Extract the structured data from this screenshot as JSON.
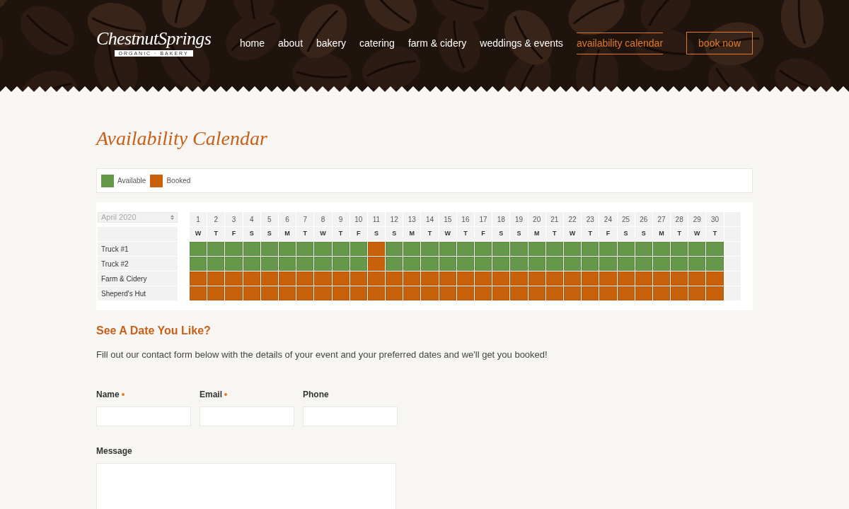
{
  "logo": {
    "name": "ChestnutSprings",
    "banner": "ORGANIC · BAKERY"
  },
  "nav": [
    {
      "label": "home",
      "selected": false
    },
    {
      "label": "about",
      "selected": false
    },
    {
      "label": "bakery",
      "selected": false
    },
    {
      "label": "catering",
      "selected": false
    },
    {
      "label": "farm & cidery",
      "selected": false
    },
    {
      "label": "weddings & events",
      "selected": false
    },
    {
      "label": "availability calendar",
      "selected": true
    }
  ],
  "book_button": "book now",
  "title": "Availability Calendar",
  "legend": [
    {
      "label": "Available",
      "color": "#66984a"
    },
    {
      "label": "Booked",
      "color": "#c9600c"
    }
  ],
  "calendar": {
    "month": "April 2020",
    "days": [
      {
        "day": "1",
        "weekday": "W"
      },
      {
        "day": "2",
        "weekday": "T"
      },
      {
        "day": "3",
        "weekday": "F"
      },
      {
        "day": "4",
        "weekday": "S"
      },
      {
        "day": "5",
        "weekday": "S"
      },
      {
        "day": "6",
        "weekday": "M"
      },
      {
        "day": "7",
        "weekday": "T"
      },
      {
        "day": "8",
        "weekday": "W"
      },
      {
        "day": "9",
        "weekday": "T"
      },
      {
        "day": "10",
        "weekday": "F"
      },
      {
        "day": "11",
        "weekday": "S"
      },
      {
        "day": "12",
        "weekday": "S"
      },
      {
        "day": "13",
        "weekday": "M"
      },
      {
        "day": "14",
        "weekday": "T"
      },
      {
        "day": "15",
        "weekday": "W"
      },
      {
        "day": "16",
        "weekday": "T"
      },
      {
        "day": "17",
        "weekday": "F"
      },
      {
        "day": "18",
        "weekday": "S"
      },
      {
        "day": "19",
        "weekday": "S"
      },
      {
        "day": "20",
        "weekday": "M"
      },
      {
        "day": "21",
        "weekday": "T"
      },
      {
        "day": "22",
        "weekday": "W"
      },
      {
        "day": "23",
        "weekday": "T"
      },
      {
        "day": "24",
        "weekday": "F"
      },
      {
        "day": "25",
        "weekday": "S"
      },
      {
        "day": "26",
        "weekday": "S"
      },
      {
        "day": "27",
        "weekday": "M"
      },
      {
        "day": "28",
        "weekday": "T"
      },
      {
        "day": "29",
        "weekday": "W"
      },
      {
        "day": "30",
        "weekday": "T"
      }
    ],
    "rows": [
      {
        "name": "Truck #1",
        "cells": [
          {
            "booked": false
          },
          {
            "booked": false
          },
          {
            "booked": false
          },
          {
            "booked": false
          },
          {
            "booked": false
          },
          {
            "booked": false
          },
          {
            "booked": false
          },
          {
            "booked": false
          },
          {
            "booked": false
          },
          {
            "booked": false
          },
          {
            "booked": true
          },
          {
            "booked": false
          },
          {
            "booked": false
          },
          {
            "booked": false
          },
          {
            "booked": false
          },
          {
            "booked": false
          },
          {
            "booked": false
          },
          {
            "booked": false
          },
          {
            "booked": false
          },
          {
            "booked": false
          },
          {
            "booked": false
          },
          {
            "booked": false
          },
          {
            "booked": false
          },
          {
            "booked": false
          },
          {
            "booked": false
          },
          {
            "booked": false
          },
          {
            "booked": false
          },
          {
            "booked": false
          },
          {
            "booked": false
          },
          {
            "booked": false
          }
        ]
      },
      {
        "name": "Truck #2",
        "cells": [
          {
            "booked": false
          },
          {
            "booked": false
          },
          {
            "booked": false
          },
          {
            "booked": false
          },
          {
            "booked": false
          },
          {
            "booked": false
          },
          {
            "booked": false
          },
          {
            "booked": false
          },
          {
            "booked": false
          },
          {
            "booked": false
          },
          {
            "booked": true
          },
          {
            "booked": false
          },
          {
            "booked": false
          },
          {
            "booked": false
          },
          {
            "booked": false
          },
          {
            "booked": false
          },
          {
            "booked": false
          },
          {
            "booked": false
          },
          {
            "booked": false
          },
          {
            "booked": false
          },
          {
            "booked": false
          },
          {
            "booked": false
          },
          {
            "booked": false
          },
          {
            "booked": false
          },
          {
            "booked": false
          },
          {
            "booked": false
          },
          {
            "booked": false
          },
          {
            "booked": false
          },
          {
            "booked": false
          },
          {
            "booked": false
          }
        ]
      },
      {
        "name": "Farm & Cidery",
        "cells": [
          {
            "booked": true
          },
          {
            "booked": true
          },
          {
            "booked": true
          },
          {
            "booked": true
          },
          {
            "booked": true
          },
          {
            "booked": true
          },
          {
            "booked": true
          },
          {
            "booked": true
          },
          {
            "booked": true
          },
          {
            "booked": true
          },
          {
            "booked": true
          },
          {
            "booked": true
          },
          {
            "booked": true
          },
          {
            "booked": true
          },
          {
            "booked": true
          },
          {
            "booked": true
          },
          {
            "booked": true
          },
          {
            "booked": true
          },
          {
            "booked": true
          },
          {
            "booked": true
          },
          {
            "booked": true
          },
          {
            "booked": true
          },
          {
            "booked": true
          },
          {
            "booked": true
          },
          {
            "booked": true
          },
          {
            "booked": true
          },
          {
            "booked": true
          },
          {
            "booked": true
          },
          {
            "booked": true
          },
          {
            "booked": true
          }
        ]
      },
      {
        "name": "Sheperd's Hut",
        "cells": [
          {
            "booked": true
          },
          {
            "booked": true
          },
          {
            "booked": true
          },
          {
            "booked": true
          },
          {
            "booked": true
          },
          {
            "booked": true
          },
          {
            "booked": true
          },
          {
            "booked": true
          },
          {
            "booked": true
          },
          {
            "booked": true
          },
          {
            "booked": true
          },
          {
            "booked": true
          },
          {
            "booked": true
          },
          {
            "booked": true
          },
          {
            "booked": true
          },
          {
            "booked": true
          },
          {
            "booked": true
          },
          {
            "booked": true
          },
          {
            "booked": true
          },
          {
            "booked": true
          },
          {
            "booked": true
          },
          {
            "booked": true
          },
          {
            "booked": true
          },
          {
            "booked": true
          },
          {
            "booked": true
          },
          {
            "booked": true
          },
          {
            "booked": true
          },
          {
            "booked": true
          },
          {
            "booked": true
          },
          {
            "booked": true
          }
        ]
      }
    ]
  },
  "cta_heading": "See A Date You Like?",
  "cta_text": "Fill out our contact form below with the details of your event and your preferred dates and we'll get you booked!",
  "form": {
    "fields": [
      {
        "label": "Name",
        "required": true
      },
      {
        "label": "Email",
        "required": true
      },
      {
        "label": "Phone",
        "required": false
      }
    ],
    "message_label": "Message"
  }
}
